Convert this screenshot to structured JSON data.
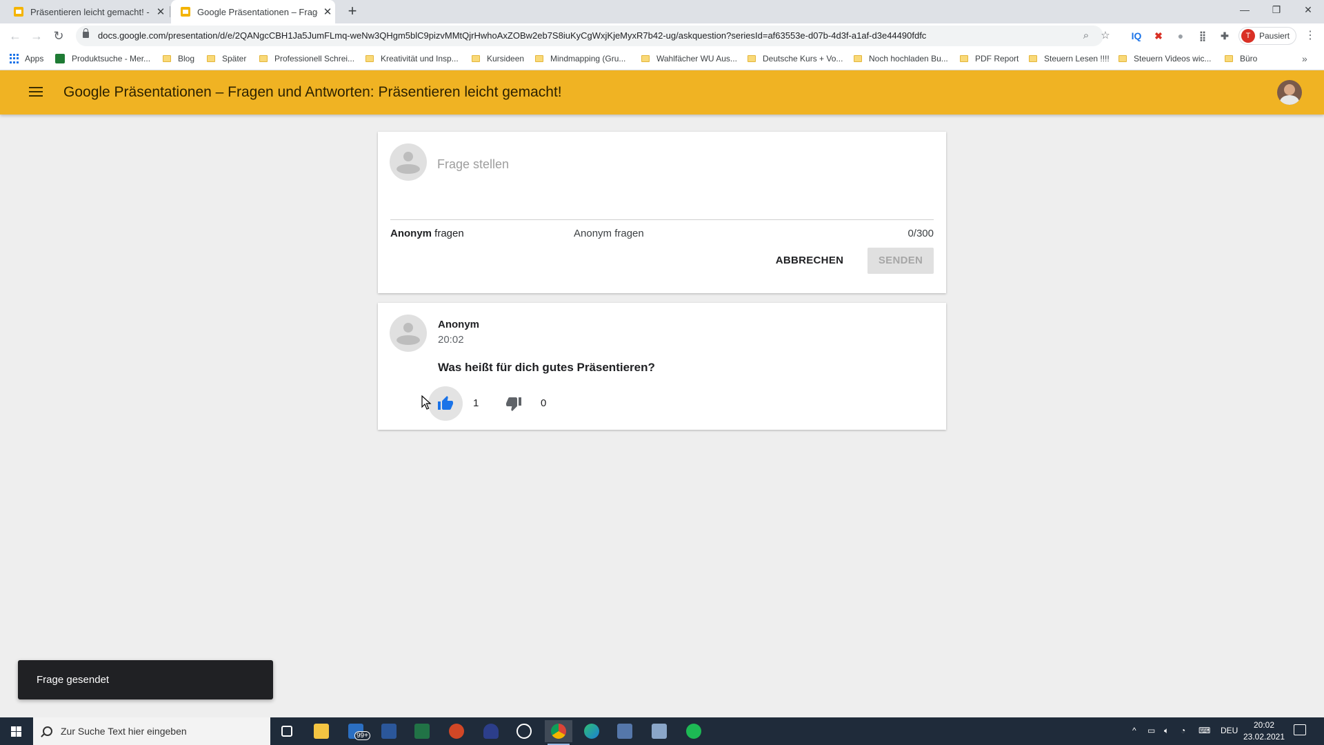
{
  "browser": {
    "tabs": [
      {
        "title": "Präsentieren leicht gemacht! - G"
      },
      {
        "title": "Google Präsentationen – Fragen"
      }
    ],
    "new_tab_label": "+",
    "url": "docs.google.com/presentation/d/e/2QANgcCBH1Ja5JumFLmq-weNw3QHgm5blC9pizvMMtQjrHwhoAxZOBw2eb7S8iuKyCgWxjKjeMyxR7b42-ug/askquestion?seriesId=af63553e-d07b-4d3f-a1af-d3e44490fdfc",
    "profile": {
      "initial": "T",
      "status": "Pausiert"
    },
    "bookmarks": [
      "Apps",
      "Produktsuche - Mer...",
      "Blog",
      "Später",
      "Professionell Schrei...",
      "Kreativität und Insp...",
      "Kursideen",
      "Mindmapping (Gru...",
      "Wahlfächer WU Aus...",
      "Deutsche Kurs + Vo...",
      "Noch hochladen Bu...",
      "PDF Report",
      "Steuern Lesen !!!!",
      "Steuern Videos wic...",
      "Büro"
    ]
  },
  "header": {
    "title": "Google Präsentationen – Fragen und Antworten: Präsentieren leicht gemacht!"
  },
  "ask": {
    "placeholder": "Frage stellen",
    "anon_bold": "Anonym",
    "anon_rest": " fragen",
    "anon_label": "Anonym fragen",
    "counter": "0/300",
    "cancel_label": "ABBRECHEN",
    "send_label": "SENDEN"
  },
  "question": {
    "author": "Anonym",
    "time": "20:02",
    "text": "Was heißt für dich gutes Präsentieren?",
    "likes": "1",
    "dislikes": "0"
  },
  "snackbar": {
    "text": "Frage gesendet"
  },
  "taskbar": {
    "search_placeholder": "Zur Suche Text hier eingeben",
    "mail_badge": "99+",
    "language": "DEU",
    "time": "20:02",
    "date": "23.02.2021"
  },
  "colors": {
    "header": "#f0b323",
    "like_active": "#1a73e8"
  }
}
